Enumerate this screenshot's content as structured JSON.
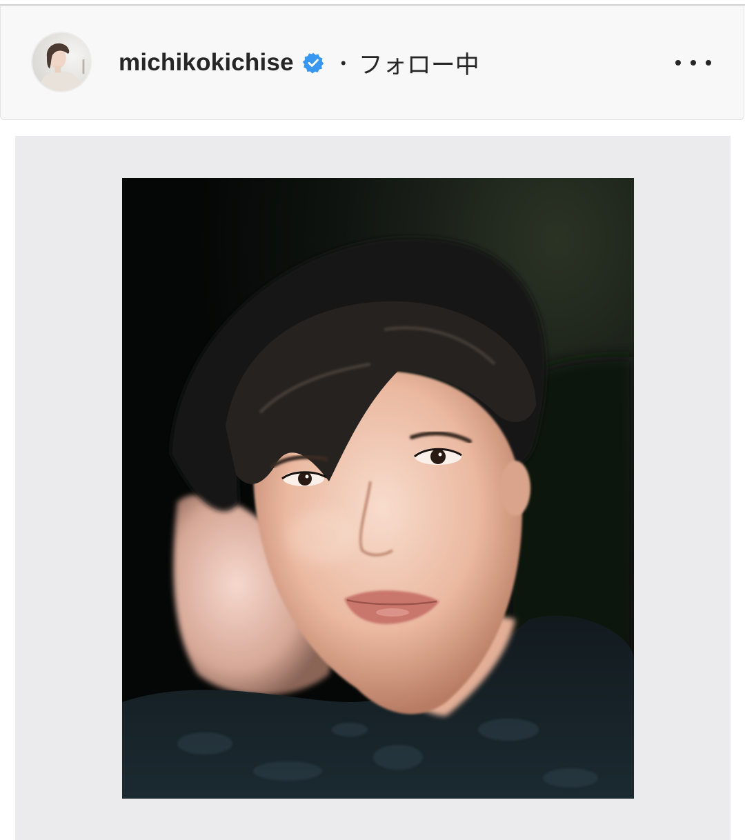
{
  "header": {
    "username": "michikokichise",
    "verified": true,
    "separator": "・",
    "follow_status": "フォロー中",
    "more_icon": "more-horizontal-icon"
  },
  "avatar": {
    "icon": "profile-avatar"
  },
  "post": {
    "image": "portrait-photo"
  },
  "colors": {
    "text": "#262626",
    "verified_badge": "#3897f0",
    "frame_background": "#ebebed",
    "header_background": "#f8f8f8"
  }
}
